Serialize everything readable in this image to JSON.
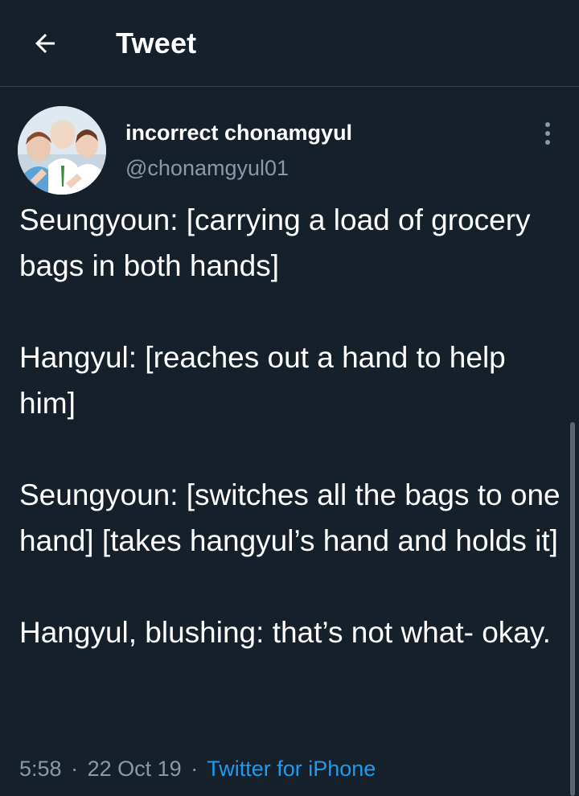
{
  "header": {
    "title": "Tweet",
    "back_icon": "arrow-left-icon"
  },
  "author": {
    "display_name": "incorrect chonamgyul",
    "handle": "@chonamgyul01",
    "avatar_icon": "avatar-photo"
  },
  "tweet": {
    "paragraphs": [
      "Seungyoun: [carrying a load of grocery bags in both hands]",
      "Hangyul: [reaches out a hand to help him]",
      "Seungyoun: [switches all the bags to one hand] [takes hangyul’s hand and holds it]",
      "Hangyul, blushing: that’s not what- okay."
    ],
    "time": "5:58",
    "date": "22 Oct 19",
    "source": "Twitter for iPhone",
    "separator": "·"
  },
  "colors": {
    "background": "#15202b",
    "text": "#ffffff",
    "secondary": "#8b98a5",
    "accent": "#1d9bf0",
    "divider": "#38444d"
  }
}
